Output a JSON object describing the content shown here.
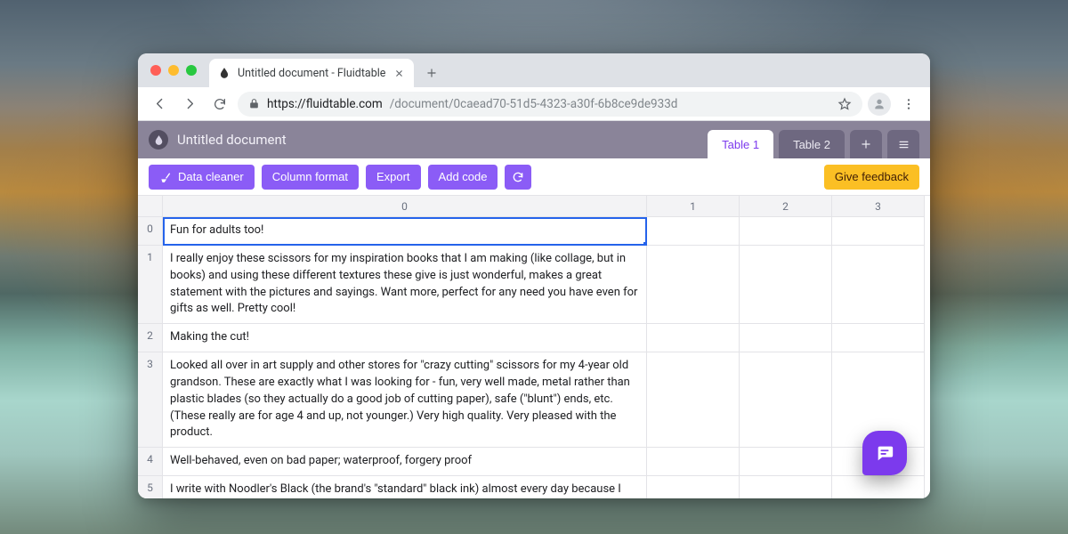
{
  "browser": {
    "tab_title": "Untitled document - Fluidtable",
    "url_host": "https://fluidtable.com",
    "url_path": "/document/0caead70-51d5-4323-a30f-6b8ce9de933d"
  },
  "app": {
    "document_title": "Untitled document",
    "tabs": [
      {
        "label": "Table 1",
        "active": true
      },
      {
        "label": "Table 2",
        "active": false
      }
    ],
    "toolbar": {
      "data_cleaner": "Data cleaner",
      "column_format": "Column format",
      "export": "Export",
      "add_code": "Add code",
      "feedback": "Give feedback"
    }
  },
  "grid": {
    "columns": [
      "0",
      "1",
      "2",
      "3"
    ],
    "rows": [
      {
        "idx": "0",
        "c0": "Fun for adults too!"
      },
      {
        "idx": "1",
        "c0": "I really enjoy these scissors for my inspiration books that I am making (like collage, but in books) and using these different textures these give is just wonderful, makes a great statement with the pictures and sayings. Want more, perfect for any need you have even for gifts as well. Pretty cool!"
      },
      {
        "idx": "2",
        "c0": "Making the cut!"
      },
      {
        "idx": "3",
        "c0": "Looked all over in art supply and other stores for \"crazy cutting\" scissors for my 4-year old grandson. These are exactly what I was looking for - fun, very well made, metal rather than plastic blades (so they actually do a good job of cutting paper), safe (\"blunt\") ends, etc. (These really are for age 4 and up, not younger.) Very high quality. Very pleased with the product."
      },
      {
        "idx": "4",
        "c0": "Well-behaved, even on bad paper; waterproof, forgery proof"
      },
      {
        "idx": "5",
        "c0": "I write with Noodler's Black (the brand's \"standard\" black ink) almost every day because I can't always choose the paper to write on. Noodler's Black can be used for two-sided writing on bad paper, even newsprint, which is rare among all the fountain pen inks in the"
      }
    ]
  }
}
